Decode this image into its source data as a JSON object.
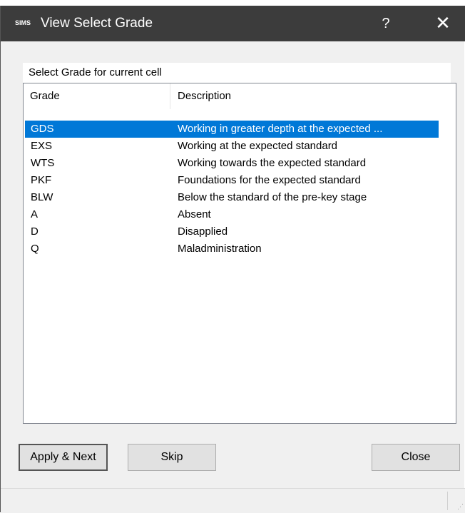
{
  "window": {
    "title": "View Select Grade",
    "app_icon_text": "SIMS",
    "help_label": "?",
    "close_label": "✕"
  },
  "group_label": "Select Grade for current cell",
  "list": {
    "columns": [
      "Grade",
      "Description"
    ],
    "rows": [
      {
        "grade": "GDS",
        "description": "Working in greater depth at the expected ...",
        "selected": true
      },
      {
        "grade": "EXS",
        "description": "Working at the expected standard",
        "selected": false
      },
      {
        "grade": "WTS",
        "description": "Working towards the expected standard",
        "selected": false
      },
      {
        "grade": "PKF",
        "description": "Foundations for the expected standard",
        "selected": false
      },
      {
        "grade": "BLW",
        "description": "Below the standard of the pre-key stage",
        "selected": false
      },
      {
        "grade": "A",
        "description": "Absent",
        "selected": false
      },
      {
        "grade": "D",
        "description": "Disapplied",
        "selected": false
      },
      {
        "grade": "Q",
        "description": "Maladministration",
        "selected": false
      }
    ]
  },
  "buttons": {
    "apply_next": "Apply & Next",
    "skip": "Skip",
    "close": "Close"
  },
  "colors": {
    "titlebar": "#3c3c3c",
    "selection": "#0078d7"
  }
}
